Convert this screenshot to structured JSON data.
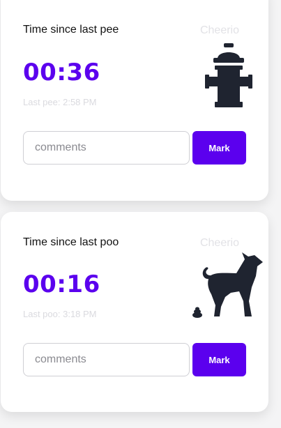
{
  "pee_card": {
    "title": "Time since last pee",
    "cheerio": "Cheerio",
    "timer": "00:36",
    "last_label": "Last pee: 2:58 PM",
    "comment_placeholder": "comments",
    "mark_label": "Mark",
    "illustration_icon": "fire-hydrant-icon"
  },
  "poo_card": {
    "title": "Time since last poo",
    "cheerio": "Cheerio",
    "timer": "00:16",
    "last_label": "Last poo: 3:18 PM",
    "comment_placeholder": "comments",
    "mark_label": "Mark",
    "illustration_icon": "dog-pooping-icon"
  },
  "colors": {
    "accent": "#5b00ee",
    "icon": "#1f2430",
    "muted": "#dadadf"
  }
}
